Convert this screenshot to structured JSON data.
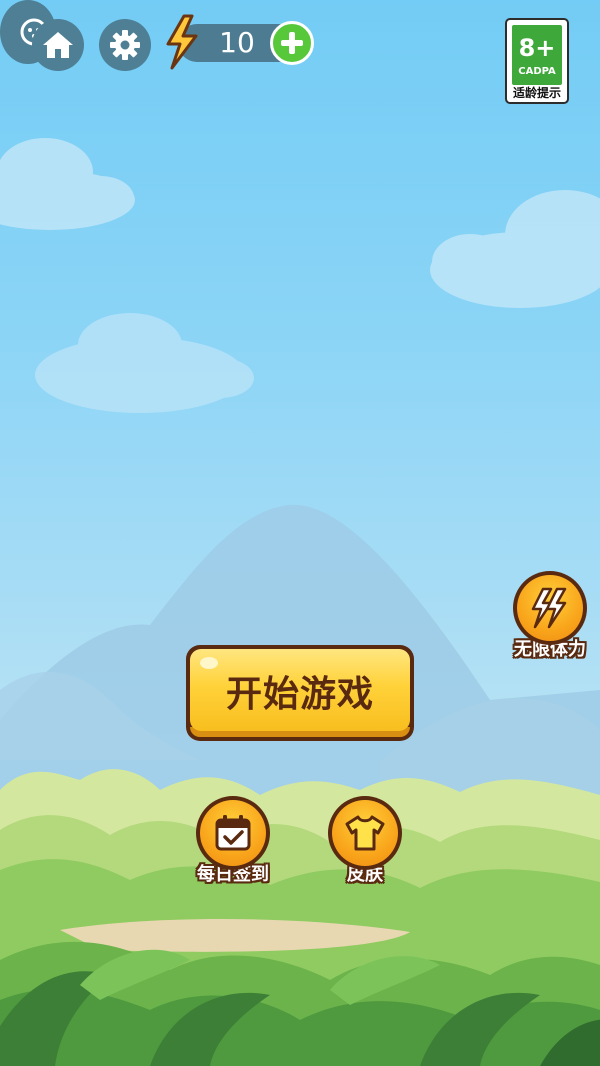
{
  "top_bar": {
    "home_icon": "home-icon",
    "settings_icon": "gear-icon",
    "side_icon": "game-controller-icon",
    "energy": {
      "icon": "lightning-icon",
      "count": "10",
      "add_icon": "plus-icon"
    }
  },
  "age_rating": {
    "rating": "8+",
    "org": "CADPA",
    "tip": "适龄提示"
  },
  "main": {
    "start_label": "开始游戏"
  },
  "features": {
    "unlimited": {
      "icon": "lightning-icon",
      "label": "无限体力"
    },
    "daily": {
      "icon": "calendar-check-icon",
      "label": "每日签到"
    },
    "skin": {
      "icon": "tshirt-icon",
      "label": "皮肤"
    }
  },
  "colors": {
    "sky": "#73ccf5",
    "accent_yellow": "#ffd23a",
    "outline_brown": "#5a2a10",
    "plus_green": "#58c83b",
    "age_green": "#3fa83a"
  }
}
